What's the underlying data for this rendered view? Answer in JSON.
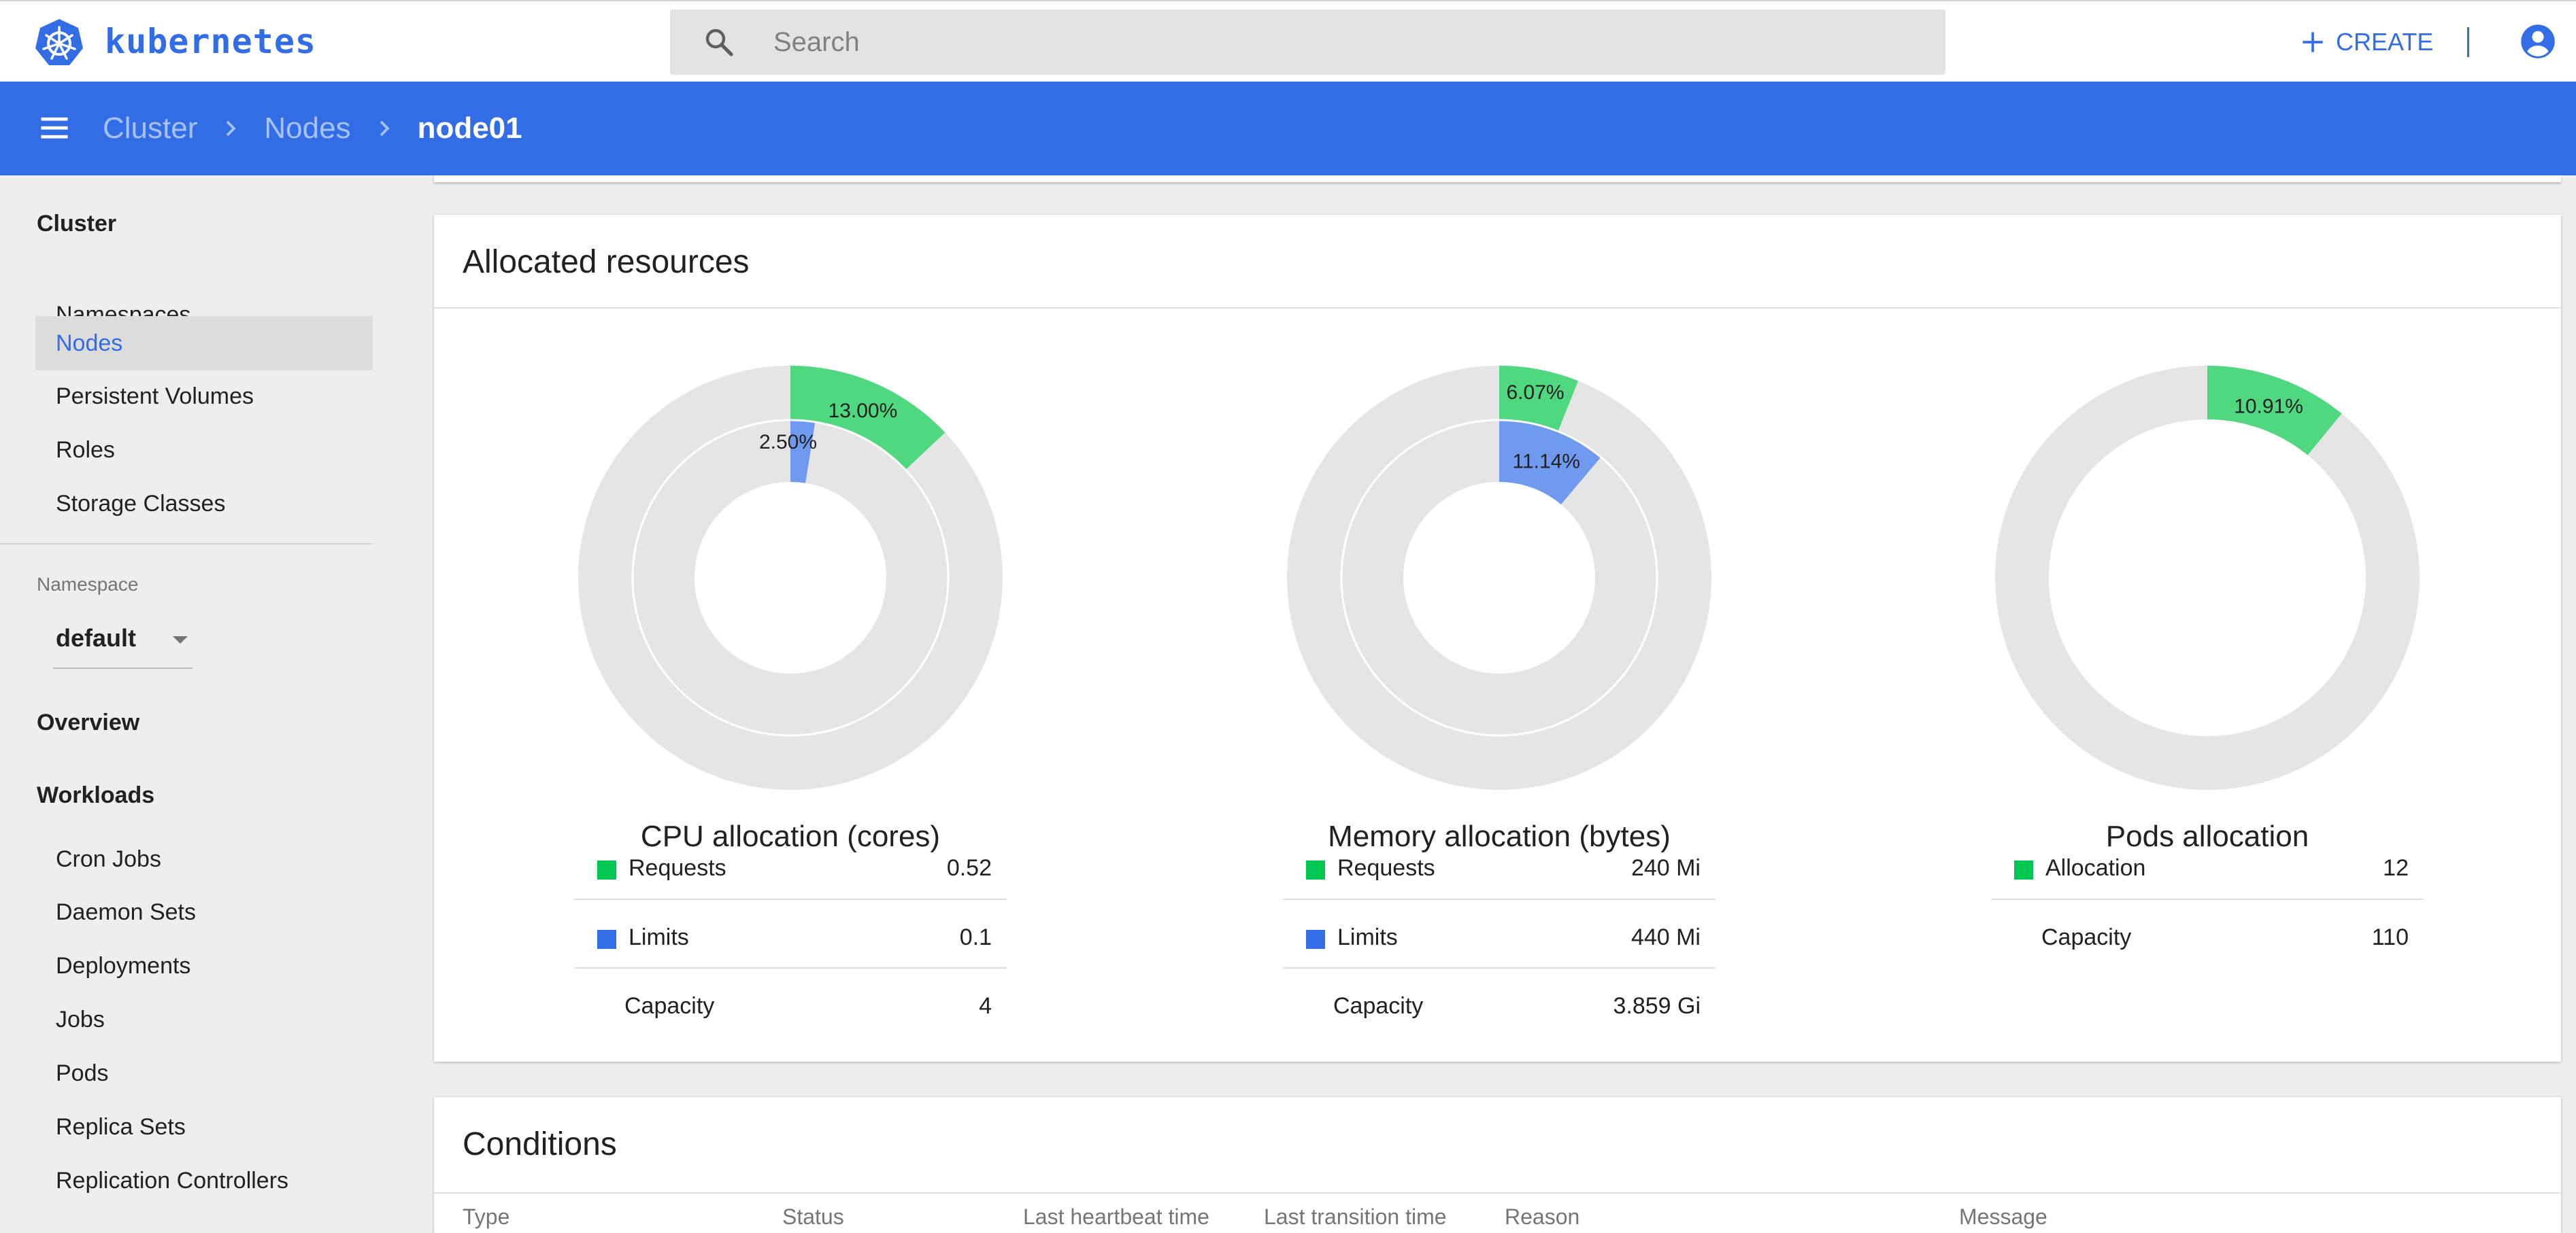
{
  "app": {
    "brand": "kubernetes",
    "search_placeholder": "Search",
    "create_label": "CREATE"
  },
  "breadcrumb": {
    "items": [
      "Cluster",
      "Nodes"
    ],
    "current": "node01"
  },
  "sidebar": {
    "cluster_heading": "Cluster",
    "cluster_items": [
      "Namespaces",
      "Nodes",
      "Persistent Volumes",
      "Roles",
      "Storage Classes"
    ],
    "active_item": "Nodes",
    "namespace_label": "Namespace",
    "namespace_value": "default",
    "overview_heading": "Overview",
    "workloads_heading": "Workloads",
    "workload_items": [
      "Cron Jobs",
      "Daemon Sets",
      "Deployments",
      "Jobs",
      "Pods",
      "Replica Sets",
      "Replication Controllers"
    ]
  },
  "allocated": {
    "title": "Allocated resources",
    "cpu": {
      "title": "CPU allocation (cores)",
      "requests_pct": 13.0,
      "limits_pct": 2.5,
      "requests_label": "13.00%",
      "limits_label": "2.50%",
      "rows": [
        {
          "name": "Requests",
          "value": "0.52"
        },
        {
          "name": "Limits",
          "value": "0.1"
        },
        {
          "name": "Capacity",
          "value": "4"
        }
      ]
    },
    "memory": {
      "title": "Memory allocation (bytes)",
      "requests_pct": 6.07,
      "limits_pct": 11.14,
      "requests_label": "6.07%",
      "limits_label": "11.14%",
      "rows": [
        {
          "name": "Requests",
          "value": "240 Mi"
        },
        {
          "name": "Limits",
          "value": "440 Mi"
        },
        {
          "name": "Capacity",
          "value": "3.859 Gi"
        }
      ]
    },
    "pods": {
      "title": "Pods allocation",
      "allocation_pct": 10.91,
      "allocation_label": "10.91%",
      "rows": [
        {
          "name": "Allocation",
          "value": "12"
        },
        {
          "name": "Capacity",
          "value": "110"
        }
      ]
    }
  },
  "conditions": {
    "title": "Conditions",
    "columns": [
      "Type",
      "Status",
      "Last heartbeat time",
      "Last transition time",
      "Reason",
      "Message"
    ]
  },
  "colors": {
    "primary": "#326de6",
    "requests_green": "#00c752",
    "limits_blue": "#326de6",
    "donut_requests": "#4fd87f",
    "donut_limits": "#6f9af0",
    "donut_bg": "#e5e5e5"
  }
}
